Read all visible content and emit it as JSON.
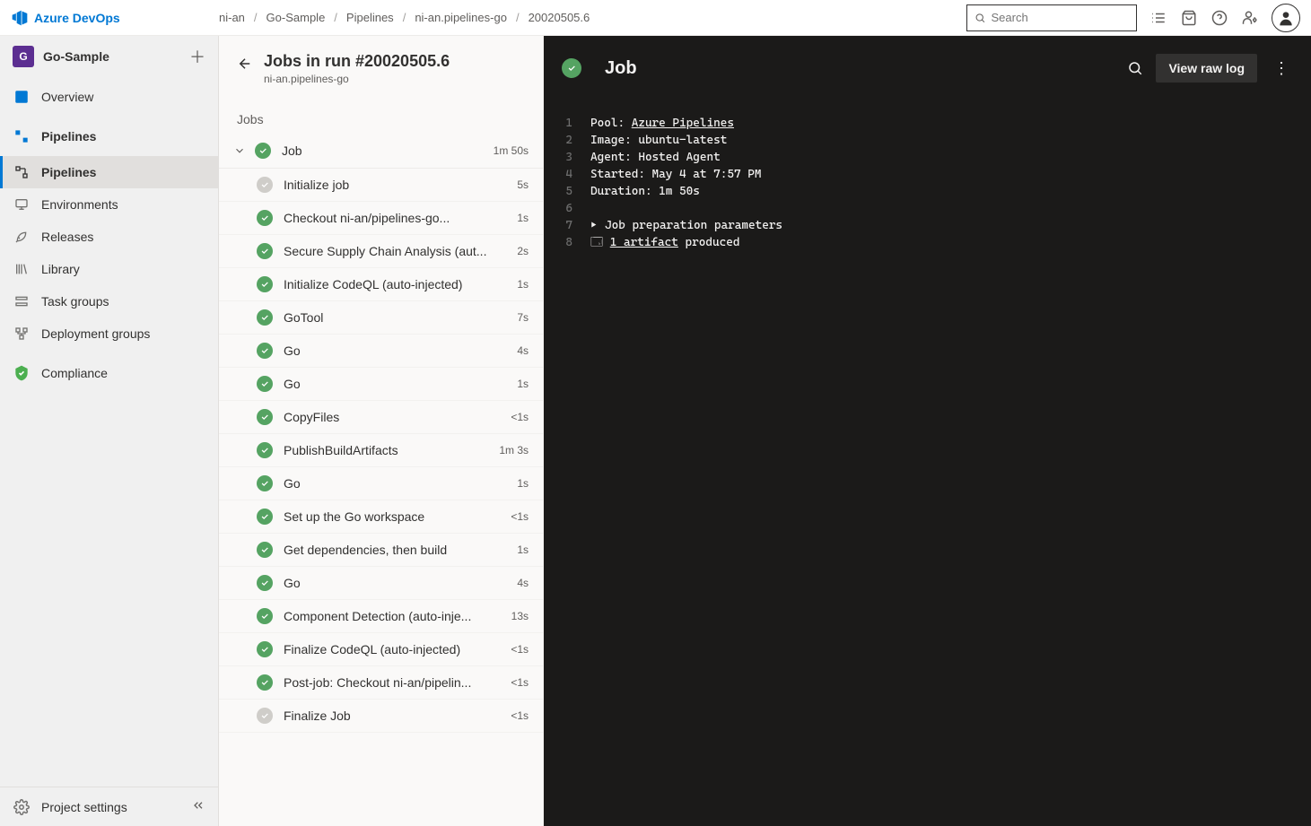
{
  "brand": "Azure DevOps",
  "breadcrumb": [
    "ni-an",
    "Go-Sample",
    "Pipelines",
    "ni-an.pipelines-go",
    "20020505.6"
  ],
  "search": {
    "placeholder": "Search"
  },
  "sidebar": {
    "project_initial": "G",
    "project_name": "Go-Sample",
    "items": [
      {
        "label": "Overview",
        "icon": "overview"
      },
      {
        "label": "Pipelines",
        "icon": "pipeline",
        "bold": true
      }
    ],
    "sub_items": [
      {
        "label": "Pipelines",
        "active": true
      },
      {
        "label": "Environments"
      },
      {
        "label": "Releases"
      },
      {
        "label": "Library"
      },
      {
        "label": "Task groups"
      },
      {
        "label": "Deployment groups"
      }
    ],
    "compliance": "Compliance",
    "footer": "Project settings"
  },
  "jobs_panel": {
    "title": "Jobs in run #20020505.6",
    "subtitle": "ni-an.pipelines-go",
    "section_label": "Jobs",
    "job_group": {
      "name": "Job",
      "duration": "1m 50s"
    },
    "steps": [
      {
        "name": "Initialize job",
        "status": "neutral",
        "time": "5s"
      },
      {
        "name": "Checkout ni-an/pipelines-go...",
        "status": "success",
        "time": "1s"
      },
      {
        "name": "Secure Supply Chain Analysis (aut...",
        "status": "success",
        "time": "2s"
      },
      {
        "name": "Initialize CodeQL (auto-injected)",
        "status": "success",
        "time": "1s"
      },
      {
        "name": "GoTool",
        "status": "success",
        "time": "7s"
      },
      {
        "name": "Go",
        "status": "success",
        "time": "4s"
      },
      {
        "name": "Go",
        "status": "success",
        "time": "1s"
      },
      {
        "name": "CopyFiles",
        "status": "success",
        "time": "<1s"
      },
      {
        "name": "PublishBuildArtifacts",
        "status": "success",
        "time": "1m 3s"
      },
      {
        "name": "Go",
        "status": "success",
        "time": "1s"
      },
      {
        "name": "Set up the Go workspace",
        "status": "success",
        "time": "<1s"
      },
      {
        "name": "Get dependencies, then build",
        "status": "success",
        "time": "1s"
      },
      {
        "name": "Go",
        "status": "success",
        "time": "4s"
      },
      {
        "name": "Component Detection (auto-inje...",
        "status": "success",
        "time": "13s"
      },
      {
        "name": "Finalize CodeQL (auto-injected)",
        "status": "success",
        "time": "<1s"
      },
      {
        "name": "Post-job: Checkout ni-an/pipelin...",
        "status": "success",
        "time": "<1s"
      },
      {
        "name": "Finalize Job",
        "status": "neutral",
        "time": "<1s"
      }
    ]
  },
  "log_panel": {
    "title": "Job",
    "view_raw_label": "View raw log",
    "lines": [
      {
        "n": 1,
        "prefix": "Pool: ",
        "link": "Azure Pipelines"
      },
      {
        "n": 2,
        "text": "Image: ubuntu-latest"
      },
      {
        "n": 3,
        "text": "Agent: Hosted Agent"
      },
      {
        "n": 4,
        "text": "Started: May 4 at 7:57 PM"
      },
      {
        "n": 5,
        "text": "Duration: 1m 50s"
      },
      {
        "n": 6,
        "text": ""
      },
      {
        "n": 7,
        "fold": true,
        "text": "Job preparation parameters"
      },
      {
        "n": 8,
        "artifact": true,
        "link": "1 artifact",
        "suffix": " produced"
      }
    ]
  }
}
